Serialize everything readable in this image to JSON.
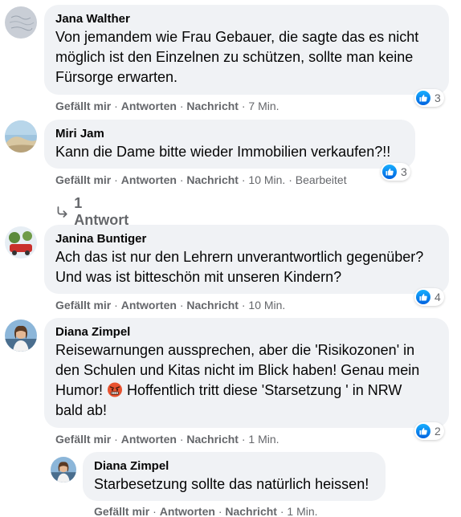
{
  "comments": [
    {
      "author": "Jana Walther",
      "text_lines": [
        "Von jemandem wie Frau Gebauer, die sagte das es nicht",
        "möglich ist den Einzelnen zu schützen, sollte man keine",
        "Fürsorge erwarten."
      ],
      "actions": {
        "like": "Gefällt mir",
        "reply": "Antworten",
        "message": "Nachricht",
        "time": "7 Min."
      },
      "reaction_count": "3"
    },
    {
      "author": "Miri Jam",
      "text_lines": [
        "Kann die Dame bitte wieder Immobilien verkaufen?!!"
      ],
      "actions": {
        "like": "Gefällt mir",
        "reply": "Antworten",
        "message": "Nachricht",
        "time": "10 Min.",
        "edited": "Bearbeitet"
      },
      "reaction_count": "3",
      "replies_label": "1 Antwort"
    },
    {
      "author": "Janina Buntiger",
      "text_lines": [
        "Ach das ist nur den Lehrern unverantwortlich gegenüber?",
        "Und was ist bitteschön mit unseren Kindern?"
      ],
      "actions": {
        "like": "Gefällt mir",
        "reply": "Antworten",
        "message": "Nachricht",
        "time": "10 Min."
      },
      "reaction_count": "4"
    },
    {
      "author": "Diana Zimpel",
      "text_lines": [
        "Reisewarnungen aussprechen, aber die 'Risikozonen' in",
        "den Schulen und Kitas nicht im Blick haben! Genau mein"
      ],
      "text_line3_before": "Humor!",
      "text_line3_after": "Hoffentlich tritt diese 'Starsetzung ' in NRW",
      "text_line4": "bald ab!",
      "actions": {
        "like": "Gefällt mir",
        "reply": "Antworten",
        "message": "Nachricht",
        "time": "1 Min."
      },
      "reaction_count": "2"
    }
  ],
  "reply": {
    "author": "Diana Zimpel",
    "text": "Starbesetzung sollte das natürlich heissen!",
    "actions": {
      "like": "Gefällt mir",
      "reply": "Antworten",
      "message": "Nachricht",
      "time": "1 Min."
    }
  },
  "icons": {
    "reaction": "like-thumb-icon",
    "replies": "reply-arrow-icon",
    "emoji": "angry-face-emoji"
  },
  "colors": {
    "bubble": "#f0f2f5",
    "secondary_text": "#65676b",
    "like_blue": "#1877f2"
  },
  "separator": "·"
}
